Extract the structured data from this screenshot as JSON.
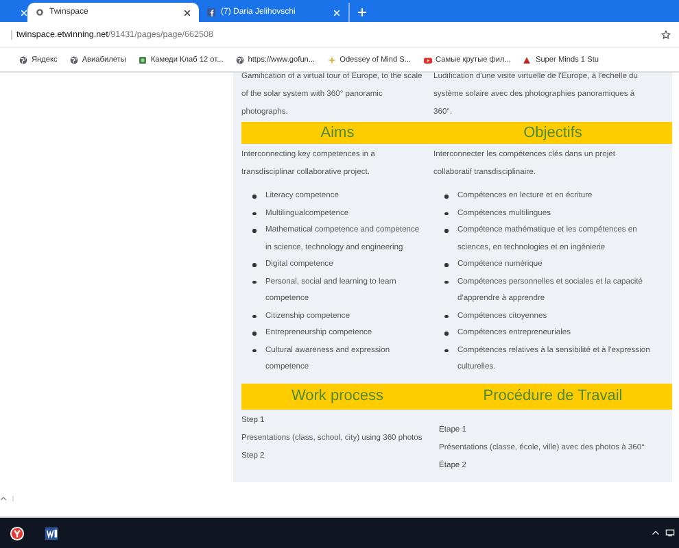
{
  "tabs": [
    {
      "selected": false
    },
    {
      "label": "Twinspace",
      "selected": true
    },
    {
      "label": "(7) Daria Jelihovschi",
      "selected": false
    }
  ],
  "address_host": "twinspace.etwinning.net",
  "address_path": "/91431/pages/page/662508",
  "bookmarks": [
    "Яндекс",
    "Авиабилеты",
    "Камеди Клаб 12 от...",
    "https://www.gofun...",
    "Odessey of Mind S...",
    "Самые крутые фил...",
    "Super Minds 1 Stu"
  ],
  "columns": [
    {
      "intro": [
        "Gamification of a virtual tour of Europe, to the scale",
        "of the solar system with 360° panoramic",
        "photographs."
      ],
      "heading": "Aims",
      "lead": "Interconnecting key competences in a transdisciplinar collaborative project.",
      "items": [
        "Literacy competence",
        "Multilingualcompetence",
        "Mathematical competence and competence in science, technology and engineering",
        "Digital competence",
        "Personal, social and learning to learn competence",
        "Citizenship competence",
        "Entrepreneurship competence",
        "Cultural awareness and expression competence"
      ],
      "heading2": "Work process",
      "steps": [
        "Step 1",
        "Presentations (class, school, city) using 360 photos",
        "Step 2"
      ]
    },
    {
      "intro": [
        "Ludification d'une visite virtuelle de l'Europe, à l'échelle du",
        "système solaire avec des photographies panoramiques à",
        "360°."
      ],
      "heading": "Objectifs",
      "lead": "Interconnecter les compétences clés dans un projet collaboratif transdisciplinaire.",
      "items": [
        "Compétences en lecture et en écriture",
        "Compétences multilingues",
        "Compétence mathématique et les compétences en sciences, en technologies et en ingénierie",
        "Compétence numérique",
        "Compétences personnelles et sociales et la capacité d'apprendre à apprendre",
        "Compétences citoyennes",
        "Compétences entrepreneuriales",
        "Compétences relatives à la sensibilité et à l'expression culturelles."
      ],
      "heading2": "Procédure de Travail",
      "steps": [
        "Étape 1",
        "Présentations (classe, école, ville) avec des photos à 360°",
        "Étape 2"
      ]
    }
  ]
}
